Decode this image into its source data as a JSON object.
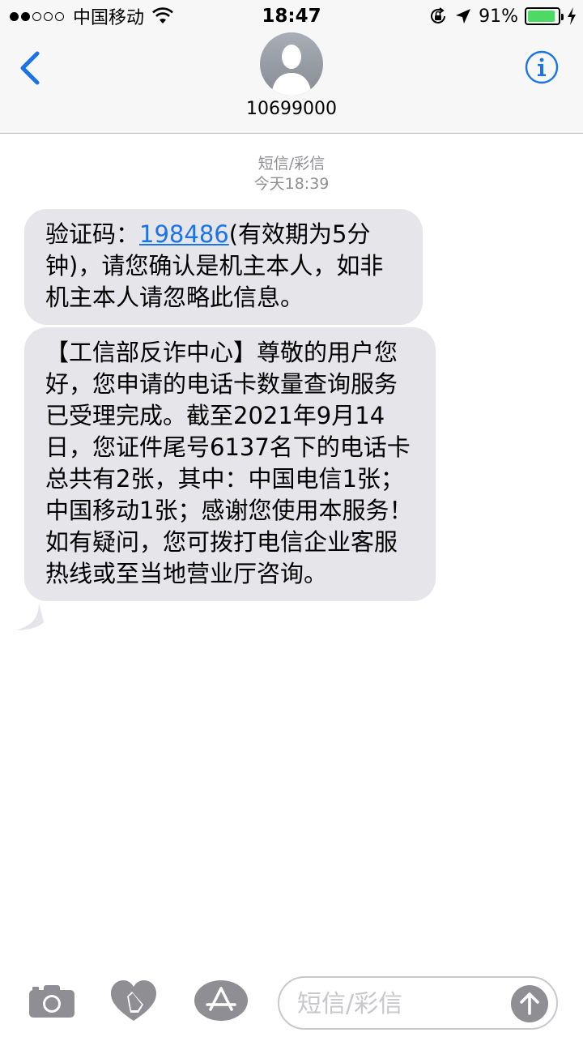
{
  "status_bar": {
    "carrier": "中国移动",
    "time": "18:47",
    "battery_percent_label": "91%",
    "battery_level": 0.91,
    "signal_bars_filled": 2,
    "signal_bars_total": 5,
    "battery_color": "#4cd964"
  },
  "header": {
    "back_icon": "chevron-left-icon",
    "contact_name": "10699000",
    "info_icon": "info-icon",
    "accent_color": "#1a73e8"
  },
  "conversation": {
    "service_label": "短信/彩信",
    "timestamp": "今天18:39",
    "messages": [
      {
        "prefix": "验证码：",
        "code": "198486",
        "suffix": "(有效期为5分钟)，请您确认是机主本人，如非机主本人请忽略此信息。"
      },
      {
        "text": "【工信部反诈中心】尊敬的用户您好，您申请的电话卡数量查询服务已受理完成。截至2021年9月14日，您证件尾号6137名下的电话卡总共有2张，其中：中国电信1张；中国移动1张；感谢您使用本服务！如有疑问，您可拨打电信企业客服热线或至当地营业厅咨询。"
      }
    ]
  },
  "toolbar": {
    "camera_icon": "camera-icon",
    "digital_touch_icon": "heart-hand-icon",
    "apps_icon": "app-store-icon",
    "input_placeholder": "短信/彩信",
    "send_icon": "arrow-up-icon"
  }
}
